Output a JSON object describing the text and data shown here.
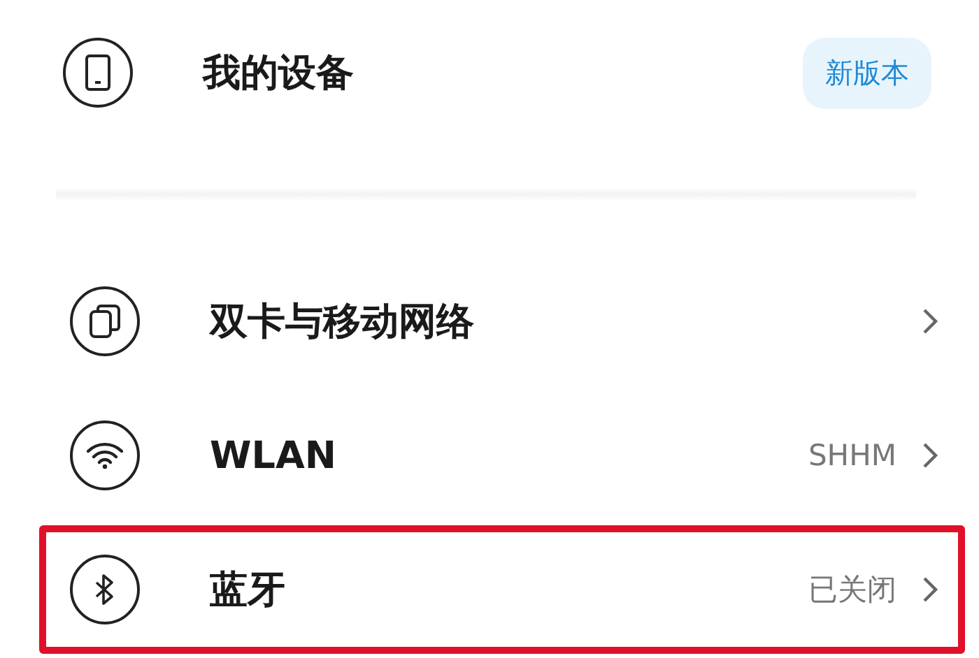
{
  "device": {
    "title": "我的设备",
    "badge": "新版本"
  },
  "settings": [
    {
      "kind": "sim",
      "label": "双卡与移动网络",
      "highlighted": false
    },
    {
      "kind": "wifi",
      "label": "WLAN",
      "value": "SHHM",
      "highlighted": false
    },
    {
      "kind": "bluetooth",
      "label": "蓝牙",
      "value": "已关闭",
      "highlighted": true
    }
  ]
}
